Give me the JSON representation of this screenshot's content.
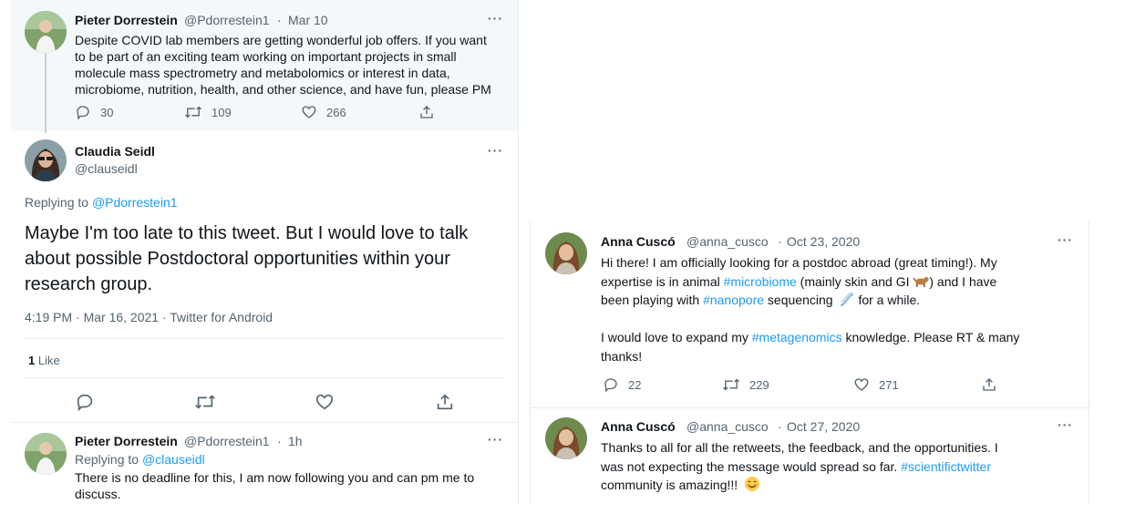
{
  "left_thread": {
    "original_tweet": {
      "author_name": "Pieter Dorrestein",
      "author_handle": "@Pdorrestein1",
      "time": "Mar 10",
      "text_lines": [
        "Despite COVID lab members are getting wonderful job offers. If you want",
        "to be part of an exciting team working on important projects in small",
        "molecule mass spectrometry and metabolomics or interest in data,",
        "microbiome, nutrition, health, and other science, and have fun, please PM"
      ],
      "replies": "30",
      "retweets": "109",
      "likes": "266"
    },
    "main_tweet": {
      "author_name": "Claudia Seidl",
      "author_handle": "@clauseidl",
      "replying_to_prefix": "Replying to",
      "replying_to_handle": "@Pdorrestein1",
      "text_lines": [
        "Maybe I'm too late to this tweet. But I would love to talk",
        "about possible Postdoctoral opportunities within your",
        "research group."
      ],
      "timestamp": "4:19 PM · Mar 16, 2021 · Twitter for Android",
      "like_count": "1",
      "like_label": "Like"
    },
    "reply_tweet": {
      "author_name": "Pieter Dorrestein",
      "author_handle": "@Pdorrestein1",
      "time": "1h",
      "replying_to_prefix": "Replying to",
      "replying_to_handle": "@clauseidl",
      "text_lines": [
        "There is no deadline for this, I am now following you and can pm me to",
        "discuss."
      ]
    }
  },
  "right_thread": {
    "tweet1": {
      "author_name": "Anna Cuscó",
      "author_handle": "@anna_cusco",
      "time": "Oct 23, 2020",
      "line1": "Hi there! I am officially looking for a postdoc abroad (great timing!). My",
      "line2_pre": "expertise is in animal ",
      "line2_tag": "#microbiome",
      "line2_post": " (mainly skin and GI",
      "line2_end": ") and I have",
      "line3_pre": "been playing with ",
      "line3_tag": "#nanopore",
      "line3_post": " sequencing",
      "line3_end": "for a while.",
      "line4_pre": "I would love to expand my ",
      "line4_tag": "#metagenomics",
      "line4_post": " knowledge. Please RT & many",
      "line5": "thanks!",
      "replies": "22",
      "retweets": "229",
      "likes": "271"
    },
    "tweet2": {
      "author_name": "Anna Cuscó",
      "author_handle": "@anna_cusco",
      "time": "Oct 27, 2020",
      "line1": "Thanks to all for all the retweets, the feedback, and the opportunities. I",
      "line2_pre": "was not expecting the message would spread so far. ",
      "line2_tag": "#scientifictwitter",
      "line3": "community is amazing!!!"
    }
  },
  "common": {
    "separator": "·",
    "more_glyph": "···"
  },
  "colors": {
    "link": "#1d9bf0",
    "muted": "#536471",
    "thread_bg": "#f5f8fa"
  }
}
